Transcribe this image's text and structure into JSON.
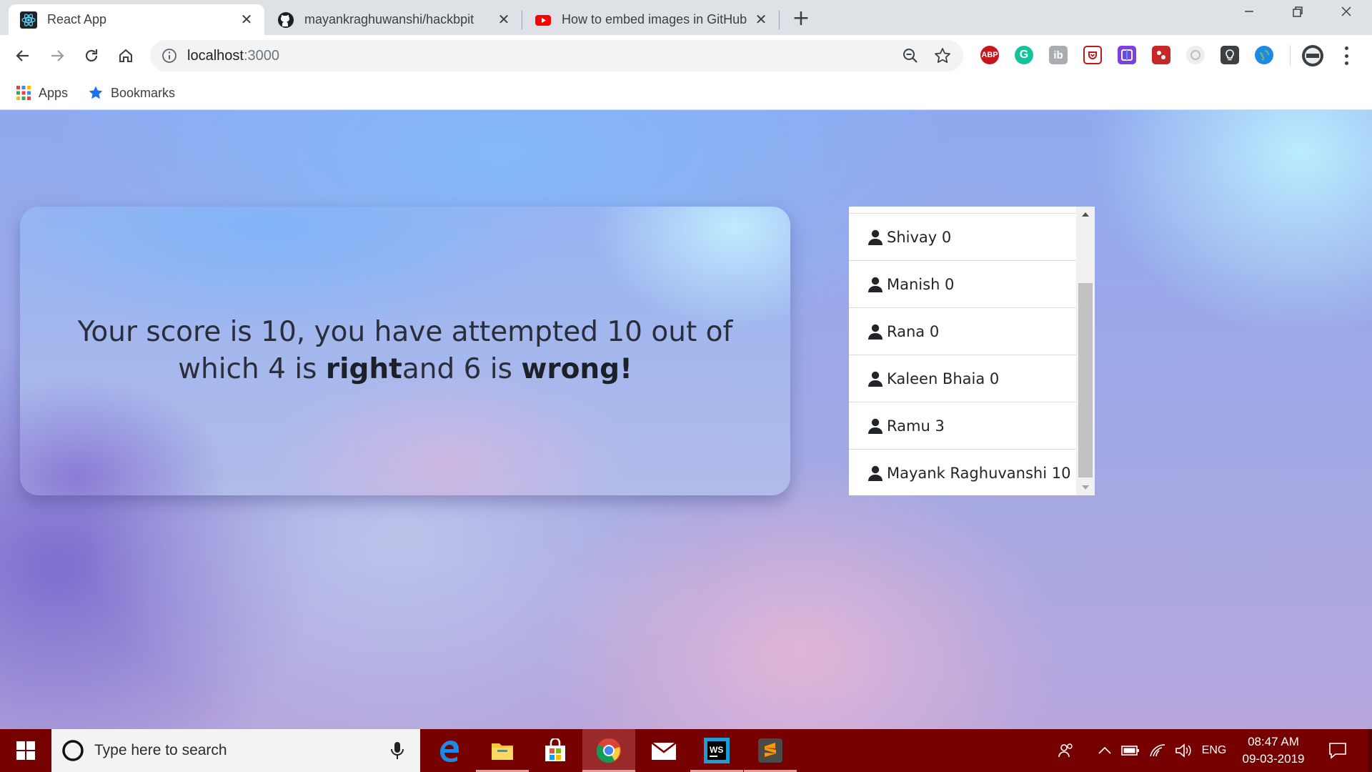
{
  "browser": {
    "tabs": [
      {
        "title": "React App",
        "icon": "react-icon",
        "active": true
      },
      {
        "title": "mayankraghuwanshi/hackbpit",
        "icon": "github-icon",
        "active": false
      },
      {
        "title": "How to embed images in GitHub",
        "icon": "youtube-icon",
        "active": false
      }
    ],
    "url_host": "localhost",
    "url_port": ":3000",
    "bookmarks": [
      {
        "label": "Apps",
        "icon": "apps-grid-icon"
      },
      {
        "label": "Bookmarks",
        "icon": "star-icon"
      }
    ],
    "extensions": [
      "adblock-plus-icon",
      "grammarly-icon",
      "ib-icon",
      "pocket-icon",
      "extension-icon",
      "extension-icon",
      "extension-icon",
      "extension-icon",
      "extension-icon"
    ],
    "extension_abp_label": "ABP",
    "extension_ib_label": "ib"
  },
  "score_card": {
    "line1": "Your score is 10, you have attempted 10 out of",
    "line2_pre": "which 4 is ",
    "right_word": "right",
    "line2_mid": "and 6 is ",
    "wrong_word": "wrong!"
  },
  "leaderboard": {
    "items": [
      {
        "label": "Shivay 0"
      },
      {
        "label": "Manish 0"
      },
      {
        "label": "Rana 0"
      },
      {
        "label": "Kaleen Bhaia 0"
      },
      {
        "label": "Ramu 3"
      },
      {
        "label": "Mayank Raghuvanshi 10"
      }
    ]
  },
  "taskbar": {
    "search_placeholder": "Type here to search",
    "language": "ENG",
    "time": "08:47 AM",
    "date": "09-03-2019",
    "ws_label": "WS",
    "color": "#760000"
  }
}
